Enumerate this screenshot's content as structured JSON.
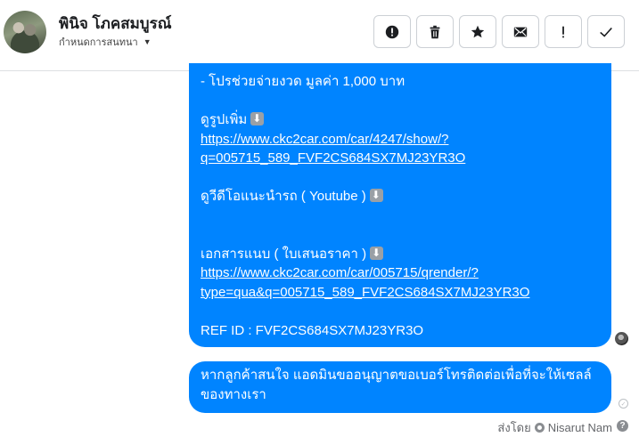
{
  "header": {
    "contact_name": "พินิจ โภคสมบูรณ์",
    "conversation_action": "กำหนดการสนทนา"
  },
  "toolbar": {
    "buttons": [
      {
        "name": "spam",
        "icon": "exclamation-circle-icon"
      },
      {
        "name": "delete",
        "icon": "trash-icon"
      },
      {
        "name": "star",
        "icon": "star-icon"
      },
      {
        "name": "unread",
        "icon": "envelope-icon"
      },
      {
        "name": "important",
        "icon": "exclamation-icon"
      },
      {
        "name": "done",
        "icon": "checkmark-icon"
      }
    ]
  },
  "messages": {
    "bubble1": {
      "promo_line": "- โปรช่วยจ่ายงวด     มูลค่า 1,000 บาท",
      "more_pics_label": "ดูรูปเพิ่ม",
      "link1_line1": "https://www.ckc2car.com/car/4247/show/?",
      "link1_line2": "q=005715_589_FVF2CS684SX7MJ23YR3O",
      "video_label": "ดูวีดีโอแนะนำรถ ( Youtube )",
      "attachment_label": "เอกสารแนบ ( ใบเสนอราคา )",
      "link2_line1": "https://www.ckc2car.com/car/005715/qrender/?",
      "link2_line2": "type=qua&q=005715_589_FVF2CS684SX7MJ23YR3O",
      "ref_id": "REF ID : FVF2CS684SX7MJ23YR3O"
    },
    "bubble2": {
      "line1": "หากลูกค้าสนใจ แอดมินขออนุญาตขอเบอร์โทรติดต่อเพื่อที่จะให้เซลล์",
      "line2": "ของทางเรา"
    }
  },
  "footer": {
    "sent_by_label": "ส่งโดย",
    "sender_name": "Nisarut Nam"
  },
  "colors": {
    "bubble": "#0084ff",
    "border": "#ccd0d5"
  }
}
